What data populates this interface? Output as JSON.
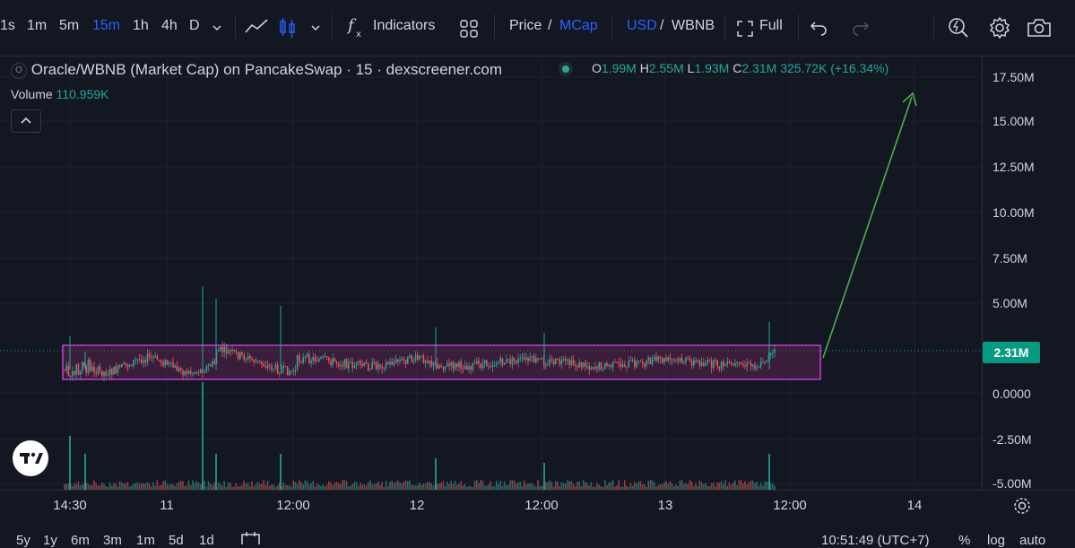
{
  "toolbar": {
    "intervals": [
      "1s",
      "1m",
      "5m",
      "15m",
      "1h",
      "4h",
      "D"
    ],
    "active_interval": "15m",
    "indicators_label": "Indicators",
    "price_label": "Price",
    "slash": "/",
    "mcap_label": "MCap",
    "usd_label": "USD",
    "wbnb_label": "WBNB",
    "full_label": "Full"
  },
  "legend": {
    "badge": "O",
    "title": "Oracle/WBNB (Market Cap) on PancakeSwap · 15 · dexscreener.com",
    "o_label": "O",
    "o_value": "1.99M",
    "h_label": "H",
    "h_value": "2.55M",
    "l_label": "L",
    "l_value": "1.93M",
    "c_label": "C",
    "c_value": "2.31M",
    "change": "325.72K (+16.34%)",
    "volume_label": "Volume",
    "volume_value": "110.959K"
  },
  "price_scale": {
    "labels": [
      "17.50M",
      "15.00M",
      "12.50M",
      "10.00M",
      "7.50M",
      "5.00M",
      "0.0000",
      "-2.50M",
      "-5.00M"
    ],
    "current_price": "2.31M",
    "current_color": "#089981"
  },
  "time_scale": {
    "labels": [
      "14:30",
      "11",
      "12:00",
      "12",
      "12:00",
      "13",
      "12:00",
      "14"
    ]
  },
  "bottom_bar": {
    "ranges": [
      "5y",
      "1y",
      "6m",
      "3m",
      "1m",
      "5d",
      "1d"
    ],
    "clock": "10:51:49 (UTC+7)",
    "percent": "%",
    "log": "log",
    "auto": "auto"
  },
  "colors": {
    "up": "#26a69a",
    "down": "#ef5350",
    "box_border": "#c13fd1",
    "box_fill": "#5a2350",
    "arrow": "#4caf50",
    "accent": "#2962ff"
  }
}
